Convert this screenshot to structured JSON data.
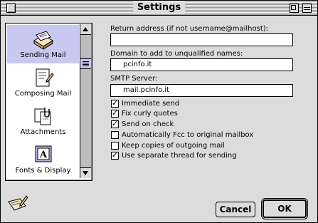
{
  "window": {
    "title": "Settings"
  },
  "sidebar": {
    "items": [
      {
        "label": "Sending Mail",
        "icon": "sending-mail-icon",
        "selected": true
      },
      {
        "label": "Composing Mail",
        "icon": "composing-mail-icon",
        "selected": false
      },
      {
        "label": "Attachments",
        "icon": "attachments-icon",
        "selected": false
      },
      {
        "label": "Fonts & Display",
        "icon": "fonts-display-icon",
        "selected": false
      }
    ]
  },
  "form": {
    "return_address": {
      "label": "Return address (if not username@mailhost):",
      "value": ""
    },
    "domain": {
      "label": "Domain to add to unqualified names:",
      "value": "pcinfo.it"
    },
    "smtp": {
      "label": "SMTP Server:",
      "value": "mail.pcinfo.it"
    },
    "options": [
      {
        "label": "Immediate send",
        "checked": true
      },
      {
        "label": "Fix curly quotes",
        "checked": true
      },
      {
        "label": "Send on check",
        "checked": true
      },
      {
        "label": "Automatically Fcc to original mailbox",
        "checked": false
      },
      {
        "label": "Keep copies of outgoing mail",
        "checked": false
      },
      {
        "label": "Use separate thread for sending",
        "checked": true
      }
    ]
  },
  "buttons": {
    "cancel": "Cancel",
    "ok": "OK"
  },
  "colors": {
    "selection": "#c8c8f0",
    "window_bg": "#dcdcdc"
  }
}
